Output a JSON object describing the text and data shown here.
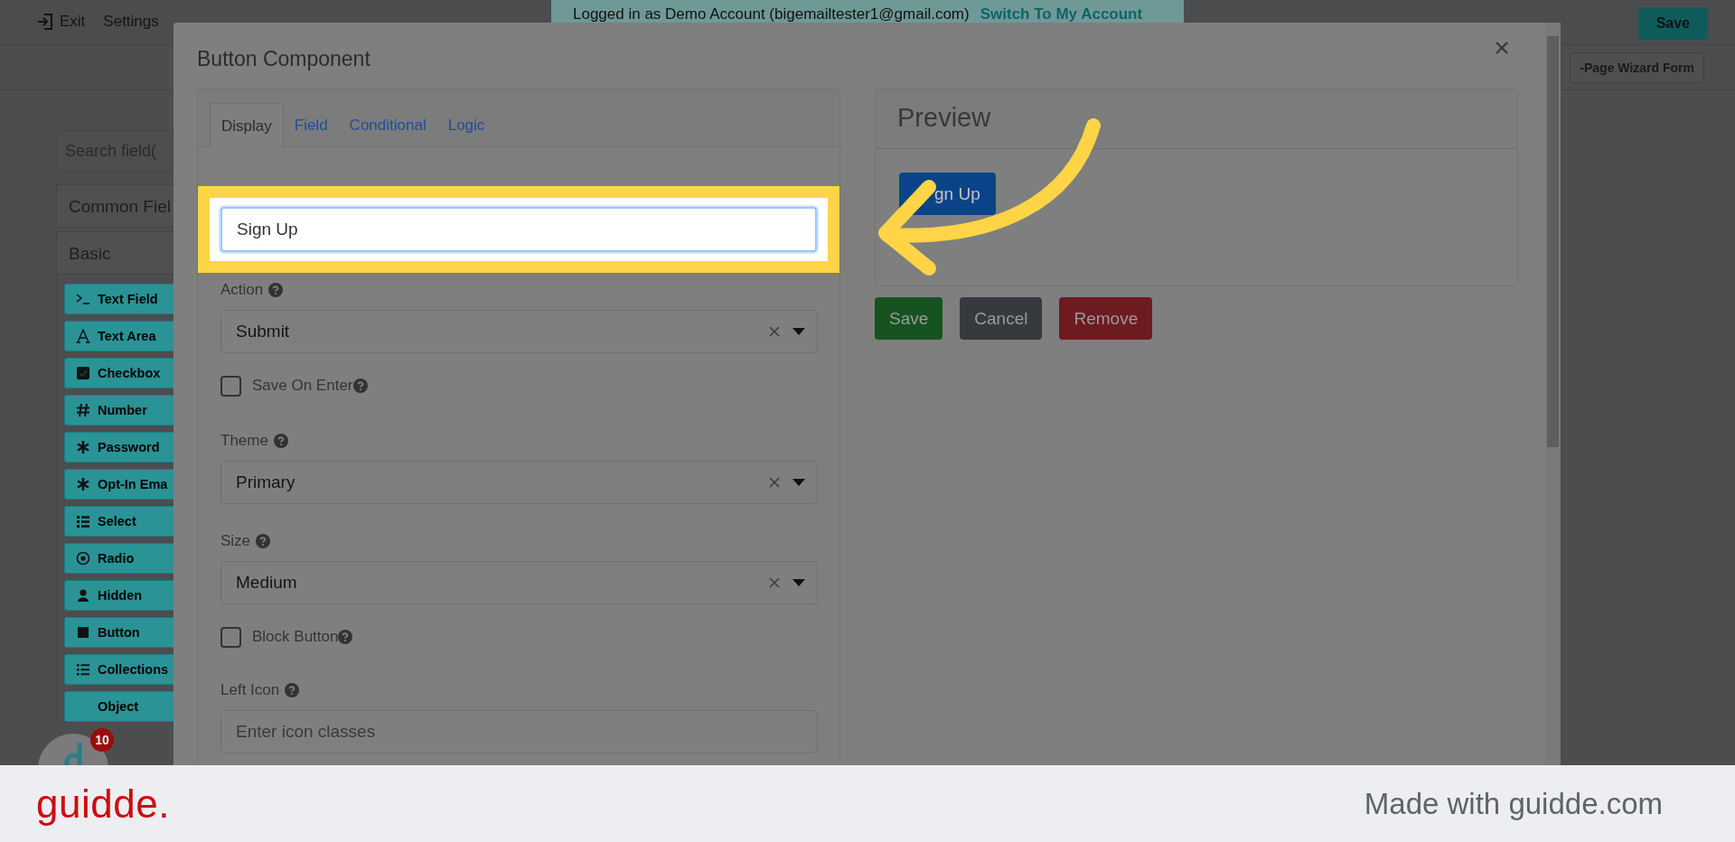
{
  "top_bar": {
    "exit": "Exit",
    "settings": "Settings",
    "banner": {
      "text": "Logged in as Demo Account (bigemailtester1@gmail.com)",
      "link": "Switch To My Account"
    },
    "save": "Save"
  },
  "toolbar": {
    "wizard": "-Page Wizard Form"
  },
  "sidebar": {
    "search": {
      "placeholder": "Search field("
    },
    "groups": [
      {
        "label": "Common Fiel"
      },
      {
        "label": "Basic"
      }
    ],
    "components": [
      "Text Field",
      "Text Area",
      "Checkbox",
      "Number",
      "Password",
      "Opt-In Ema",
      "Select",
      "Radio",
      "Hidden",
      "Button",
      "Collections",
      "Object"
    ]
  },
  "chat_widget": {
    "badge": "10"
  },
  "modal": {
    "title": "Button Component",
    "tabs": [
      {
        "label": "Display",
        "selected": true
      },
      {
        "label": "Field",
        "selected": false
      },
      {
        "label": "Conditional",
        "selected": false
      },
      {
        "label": "Logic",
        "selected": false
      }
    ],
    "fields": [
      {
        "kind": "text",
        "value": "Sign Up",
        "highlighted": true
      },
      {
        "kind": "select",
        "label": "Action",
        "value": "Submit"
      },
      {
        "kind": "checkbox",
        "label": "Save On Enter",
        "checked": false
      },
      {
        "kind": "select",
        "label": "Theme",
        "value": "Primary"
      },
      {
        "kind": "select",
        "label": "Size",
        "value": "Medium"
      },
      {
        "kind": "checkbox",
        "label": "Block Button",
        "checked": false
      },
      {
        "kind": "text",
        "label": "Left Icon",
        "placeholder": "Enter icon classes",
        "highlighted": false
      }
    ],
    "preview": {
      "title": "Preview",
      "button": "gn Up"
    },
    "actions": [
      {
        "kind": "success",
        "label": "Save"
      },
      {
        "kind": "secondary",
        "label": "Cancel"
      },
      {
        "kind": "danger",
        "label": "Remove"
      }
    ]
  },
  "footer": {
    "logo": "guidde.",
    "credit": "Made with guidde.com"
  }
}
